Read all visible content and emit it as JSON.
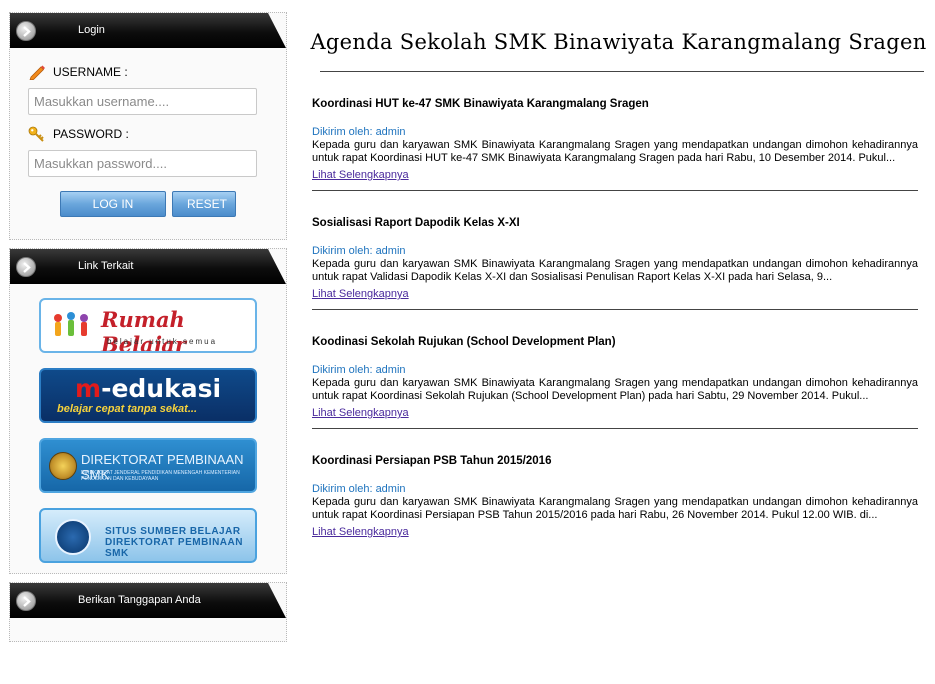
{
  "sidebar": {
    "login": {
      "header": "Login",
      "username_label": "USERNAME :",
      "username_placeholder": "Masukkan username....",
      "password_label": "PASSWORD :",
      "password_placeholder": "Masukkan password....",
      "login_button": "LOG IN",
      "reset_button": "RESET"
    },
    "links": {
      "header": "Link Terkait",
      "banners": [
        {
          "title": "Rumah Belajar",
          "sub": "belajar untuk semua"
        },
        {
          "title_accent": "m",
          "title_rest": "-edukasi",
          "sub": "belajar cepat tanpa sekat..."
        },
        {
          "title": "DIREKTORAT PEMBINAAN SMK",
          "sub": "DIREKTORAT JENDERAL PENDIDIKAN MENENGAH KEMENTERIAN PENDIDIKAN DAN KEBUDAYAAN"
        },
        {
          "title_line1": "SITUS SUMBER BELAJAR",
          "title_line2": "DIREKTORAT PEMBINAAN SMK"
        }
      ]
    },
    "feedback": {
      "header": "Berikan Tanggapan Anda"
    }
  },
  "main": {
    "title": "Agenda Sekolah SMK Binawiyata Karangmalang Sragen",
    "articles": [
      {
        "title": "Koordinasi HUT ke-47 SMK Binawiyata Karangmalang Sragen",
        "author": "Dikirim oleh: admin",
        "excerpt": "Kepada guru dan karyawan SMK Binawiyata Karangmalang Sragen yang mendapatkan undangan dimohon kehadirannya untuk rapat Koordinasi HUT ke-47 SMK Binawiyata Karangmalang Sragen pada hari Rabu, 10 Desember 2014. Pukul...",
        "more": "Lihat Selengkapnya"
      },
      {
        "title": "Sosialisasi Raport Dapodik Kelas X-XI",
        "author": "Dikirim oleh: admin",
        "excerpt": "Kepada guru dan karyawan SMK Binawiyata Karangmalang Sragen yang mendapatkan undangan dimohon kehadirannya untuk rapat Validasi Dapodik Kelas X-XI dan Sosialisasi Penulisan Raport Kelas X-XI pada hari Selasa, 9...",
        "more": "Lihat Selengkapnya"
      },
      {
        "title": "Koodinasi Sekolah Rujukan (School Development Plan)",
        "author": "Dikirim oleh: admin",
        "excerpt": "Kepada guru dan karyawan SMK Binawiyata Karangmalang Sragen yang mendapatkan undangan dimohon kehadirannya untuk rapat Koordinasi Sekolah Rujukan (School Development Plan) pada hari Sabtu, 29 November 2014. Pukul...",
        "more": "Lihat Selengkapnya"
      },
      {
        "title": "Koordinasi Persiapan PSB Tahun 2015/2016",
        "author": "Dikirim oleh: admin",
        "excerpt": "Kepada guru dan karyawan SMK Binawiyata Karangmalang Sragen yang mendapatkan undangan dimohon kehadirannya untuk rapat Koordinasi Persiapan PSB Tahun 2015/2016 pada hari Rabu, 26 November 2014. Pukul 12.00 WIB. di...",
        "more": "Lihat Selengkapnya"
      }
    ]
  }
}
